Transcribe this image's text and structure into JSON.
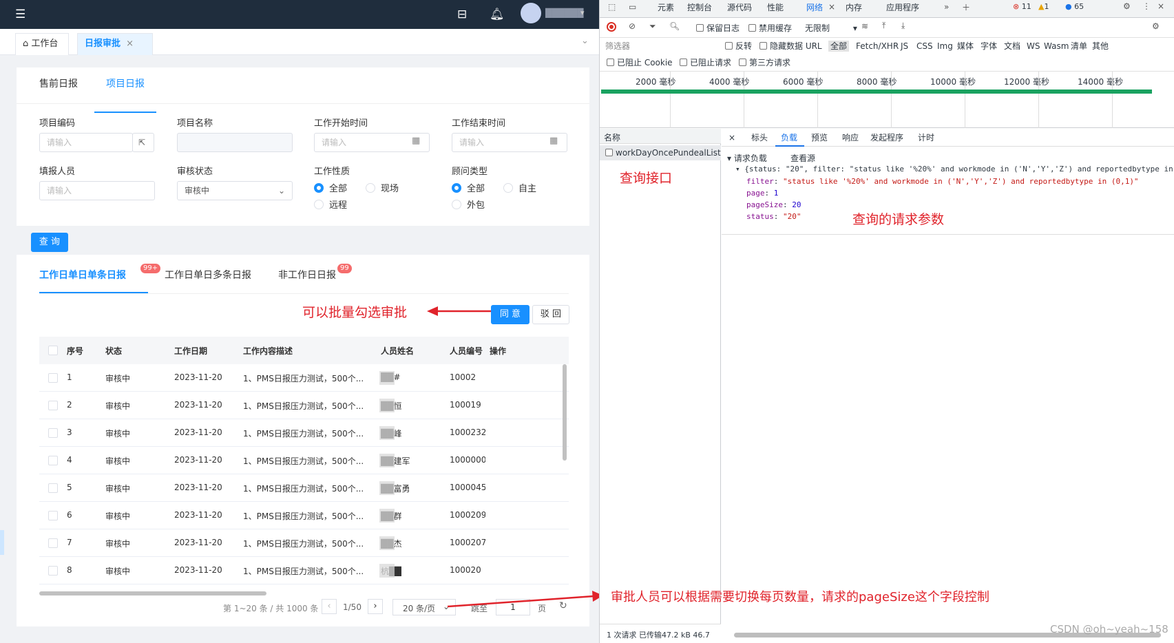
{
  "topbar": {
    "menu_icon": "menu-icon",
    "mail_icon": "inbox-icon",
    "bell_icon": "bell-icon",
    "avatar_icon": "avatar-icon",
    "user_name": "██████"
  },
  "page_tabs": {
    "home": "工作台",
    "active": "日报审批",
    "close": "×"
  },
  "sub_tabs": [
    "售前日报",
    "项目日报"
  ],
  "form": {
    "project_code_label": "项目编码",
    "project_code_placeholder": "请输入",
    "project_name_label": "项目名称",
    "start_label": "工作开始时间",
    "start_placeholder": "请输入",
    "end_label": "工作结束时间",
    "end_placeholder": "请输入",
    "reporter_label": "填报人员",
    "reporter_placeholder": "请输入",
    "status_label": "审核状态",
    "status_value": "审核中",
    "nature_label": "工作性质",
    "nature_options": [
      "全部",
      "现场",
      "远程"
    ],
    "nature_selected": "全部",
    "consultant_label": "顾问类型",
    "consultant_options": [
      "全部",
      "自主",
      "外包"
    ],
    "consultant_selected": "全部",
    "query_button": "查 询"
  },
  "list_tabs": [
    {
      "label": "工作日单日单条日报",
      "badge": "99+"
    },
    {
      "label": "工作日单日多条日报",
      "badge": ""
    },
    {
      "label": "非工作日日报",
      "badge": "99"
    }
  ],
  "actions": {
    "approve": "同 意",
    "reject": "驳 回"
  },
  "table": {
    "headers": [
      "序号",
      "状态",
      "工作日期",
      "工作内容描述",
      "人员姓名",
      "人员编号",
      "操作"
    ],
    "rows": [
      {
        "no": "1",
        "status": "审核中",
        "date": "2023-11-20",
        "desc": "1、PMS日报压力测试，500个...",
        "name": "██#",
        "id": "10002"
      },
      {
        "no": "2",
        "status": "审核中",
        "date": "2023-11-20",
        "desc": "1、PMS日报压力测试，500个...",
        "name": "██恒",
        "id": "100019"
      },
      {
        "no": "3",
        "status": "审核中",
        "date": "2023-11-20",
        "desc": "1、PMS日报压力测试，500个...",
        "name": "██峰",
        "id": "1000232"
      },
      {
        "no": "4",
        "status": "审核中",
        "date": "2023-11-20",
        "desc": "1、PMS日报压力测试，500个...",
        "name": "██建军",
        "id": "1000000"
      },
      {
        "no": "5",
        "status": "审核中",
        "date": "2023-11-20",
        "desc": "1、PMS日报压力测试，500个...",
        "name": "██富勇",
        "id": "1000045"
      },
      {
        "no": "6",
        "status": "审核中",
        "date": "2023-11-20",
        "desc": "1、PMS日报压力测试，500个...",
        "name": "██群",
        "id": "1000209"
      },
      {
        "no": "7",
        "status": "审核中",
        "date": "2023-11-20",
        "desc": "1、PMS日报压力测试，500个...",
        "name": "██杰",
        "id": "1000207"
      },
      {
        "no": "8",
        "status": "审核中",
        "date": "2023-11-20",
        "desc": "1、PMS日报压力测试，500个...",
        "name": "杭██",
        "id": "100020"
      }
    ]
  },
  "pagination": {
    "summary": "第 1~20 条 / 共 1000 条",
    "page": "1/50",
    "page_size": "20 条/页",
    "jump_label": "跳至",
    "jump_value": "1",
    "page_unit": "页"
  },
  "annotations": {
    "batch": "可以批量勾选审批",
    "page_size": "审批人员可以根据需要切换每页数量，请求的pageSize这个字段控制",
    "interface": "查询接口",
    "params": "查询的请求参数"
  },
  "devtools": {
    "tabs": [
      "元素",
      "控制台",
      "源代码",
      "性能",
      "网络",
      "内存",
      "应用程序"
    ],
    "active_tab": "网络",
    "errors": "11",
    "warnings": "1",
    "infos": "65",
    "toolbar": {
      "preserve_log": "保留日志",
      "disable_cache": "禁用缓存",
      "throttle": "无限制"
    },
    "filter": {
      "placeholder": "筛选器",
      "invert": "反转",
      "hide_data_urls": "隐藏数据 URL",
      "types": [
        "全部",
        "Fetch/XHR",
        "JS",
        "CSS",
        "Img",
        "媒体",
        "字体",
        "文档",
        "WS",
        "Wasm",
        "清单",
        "其他"
      ]
    },
    "filter2": [
      "已阻止 Cookie",
      "已阻止请求",
      "第三方请求"
    ],
    "timeline_ticks": [
      "2000 毫秒",
      "4000 毫秒",
      "6000 毫秒",
      "8000 毫秒",
      "10000 毫秒",
      "12000 毫秒",
      "14000 毫秒"
    ],
    "name_header": "名称",
    "request_name": "workDayOncePundealList",
    "detail_tabs": [
      "标头",
      "负载",
      "预览",
      "响应",
      "发起程序",
      "计时"
    ],
    "active_detail": "负载",
    "payload_title": "请求负载",
    "view_source": "查看源",
    "payload_line1": "{status: \"20\", filter: \"status like '%20%' and workmode in ('N','Y','Z') and reportedbytype in",
    "payload_filter_key": "filter",
    "payload_filter_val": "\"status like '%20%' and workmode in ('N','Y','Z') and reportedbytype in (0,1)\"",
    "payload_page_key": "page",
    "payload_page_val": "1",
    "payload_size_key": "pageSize",
    "payload_size_val": "20",
    "payload_status_key": "status",
    "payload_status_val": "\"20\"",
    "status_bar": "1 次请求  已传输47.2 kB  46.7",
    "watermark": "CSDN @oh~yeah~158"
  },
  "colors": {
    "primary": "#1890ff",
    "annotation": "#e0232b",
    "topbar": "#1f2d3d",
    "badge": "#f56c6c"
  }
}
